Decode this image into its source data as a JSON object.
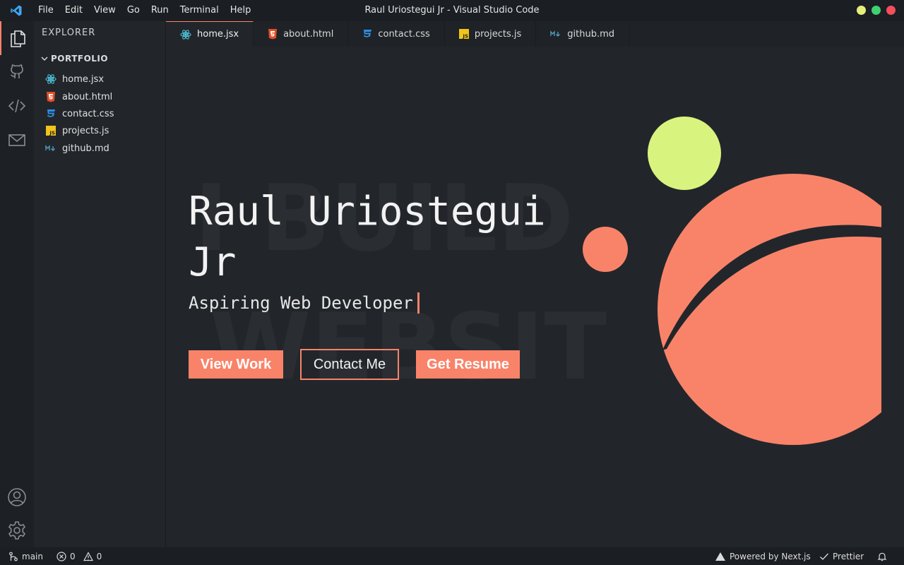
{
  "window": {
    "title": "Raul Uriostegui Jr - Visual Studio Code",
    "menu": [
      "File",
      "Edit",
      "View",
      "Go",
      "Run",
      "Terminal",
      "Help"
    ]
  },
  "sidebar": {
    "heading": "EXPLORER",
    "folder": "PORTFOLIO",
    "files": [
      {
        "name": "home.jsx",
        "icon": "react-icon"
      },
      {
        "name": "about.html",
        "icon": "html5-icon"
      },
      {
        "name": "contact.css",
        "icon": "css3-icon"
      },
      {
        "name": "projects.js",
        "icon": "javascript-icon"
      },
      {
        "name": "github.md",
        "icon": "markdown-icon"
      }
    ]
  },
  "tabs": [
    {
      "label": "home.jsx",
      "icon": "react-icon",
      "active": true
    },
    {
      "label": "about.html",
      "icon": "html5-icon"
    },
    {
      "label": "contact.css",
      "icon": "css3-icon"
    },
    {
      "label": "projects.js",
      "icon": "javascript-icon"
    },
    {
      "label": "github.md",
      "icon": "markdown-icon"
    }
  ],
  "hero": {
    "name": "Raul Uriostegui Jr",
    "subtitle": "Aspiring Web Developer",
    "background_text_1": "I BUILD",
    "background_text_2": "WEBSIT",
    "buttons": {
      "view_work": "View Work",
      "contact": "Contact Me",
      "resume": "Get Resume"
    }
  },
  "statusbar": {
    "branch": "main",
    "errors": "0",
    "warnings": "0",
    "powered": "Powered by Next.js",
    "prettier": "Prettier"
  },
  "colors": {
    "accent": "#f98369",
    "lime": "#d9f47e",
    "background": "#22262b",
    "react": "#4fc1d9",
    "html": "#e44d26",
    "css": "#2d8fe6",
    "js": "#f0c419",
    "markdown": "#519aba"
  }
}
